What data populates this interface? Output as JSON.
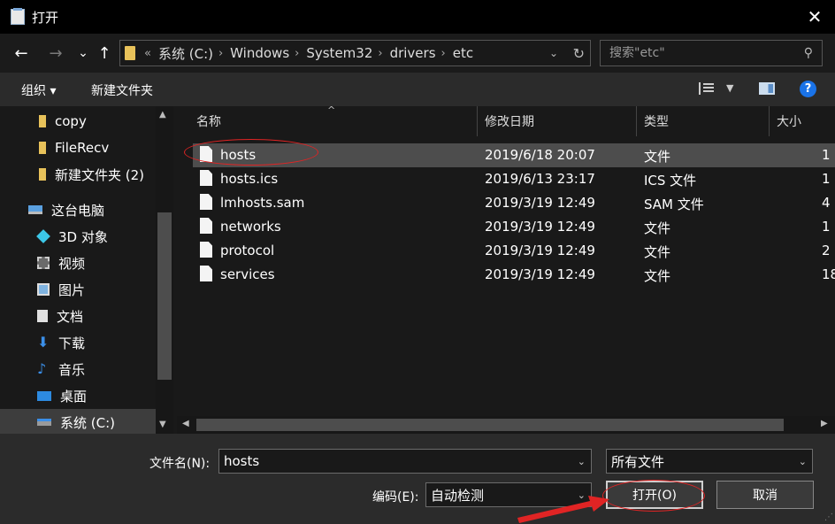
{
  "window": {
    "title": "打开",
    "close_glyph": "✕"
  },
  "nav_buttons": {
    "back": "←",
    "forward": "→",
    "recent": "⌄",
    "up": "↑"
  },
  "breadcrumb": {
    "overflow": "«",
    "items": [
      "系统 (C:)",
      "Windows",
      "System32",
      "drivers",
      "etc"
    ],
    "separator": "›"
  },
  "search": {
    "placeholder": "搜索\"etc\""
  },
  "toolbar": {
    "organize": "组织 ▾",
    "new_folder": "新建文件夹",
    "help": "?"
  },
  "sidebar": {
    "items": [
      {
        "label": "copy",
        "icon": "folder-icon"
      },
      {
        "label": "FileRecv",
        "icon": "folder-icon"
      },
      {
        "label": "新建文件夹 (2)",
        "icon": "folder-icon"
      },
      {
        "label": "这台电脑",
        "icon": "computer-icon"
      },
      {
        "label": "3D 对象",
        "icon": "cube-icon"
      },
      {
        "label": "视频",
        "icon": "video-icon"
      },
      {
        "label": "图片",
        "icon": "picture-icon"
      },
      {
        "label": "文档",
        "icon": "document-icon"
      },
      {
        "label": "下载",
        "icon": "download-icon"
      },
      {
        "label": "音乐",
        "icon": "music-icon"
      },
      {
        "label": "桌面",
        "icon": "desktop-icon"
      },
      {
        "label": "系统 (C:)",
        "icon": "drive-icon"
      }
    ]
  },
  "file_list": {
    "columns": [
      "名称",
      "修改日期",
      "类型",
      "大小"
    ],
    "rows": [
      {
        "name": "hosts",
        "date": "2019/6/18 20:07",
        "type": "文件",
        "size": "1"
      },
      {
        "name": "hosts.ics",
        "date": "2019/6/13 23:17",
        "type": "ICS 文件",
        "size": "1"
      },
      {
        "name": "lmhosts.sam",
        "date": "2019/3/19 12:49",
        "type": "SAM 文件",
        "size": "4"
      },
      {
        "name": "networks",
        "date": "2019/3/19 12:49",
        "type": "文件",
        "size": "1"
      },
      {
        "name": "protocol",
        "date": "2019/3/19 12:49",
        "type": "文件",
        "size": "2"
      },
      {
        "name": "services",
        "date": "2019/3/19 12:49",
        "type": "文件",
        "size": "18"
      }
    ]
  },
  "footer": {
    "filename_label": "文件名(N):",
    "filename_value": "hosts",
    "filetype_value": "所有文件",
    "encoding_label": "编码(E):",
    "encoding_value": "自动检测",
    "open_button": "打开(O)",
    "cancel_button": "取消"
  },
  "annotation_color": "#e02424"
}
